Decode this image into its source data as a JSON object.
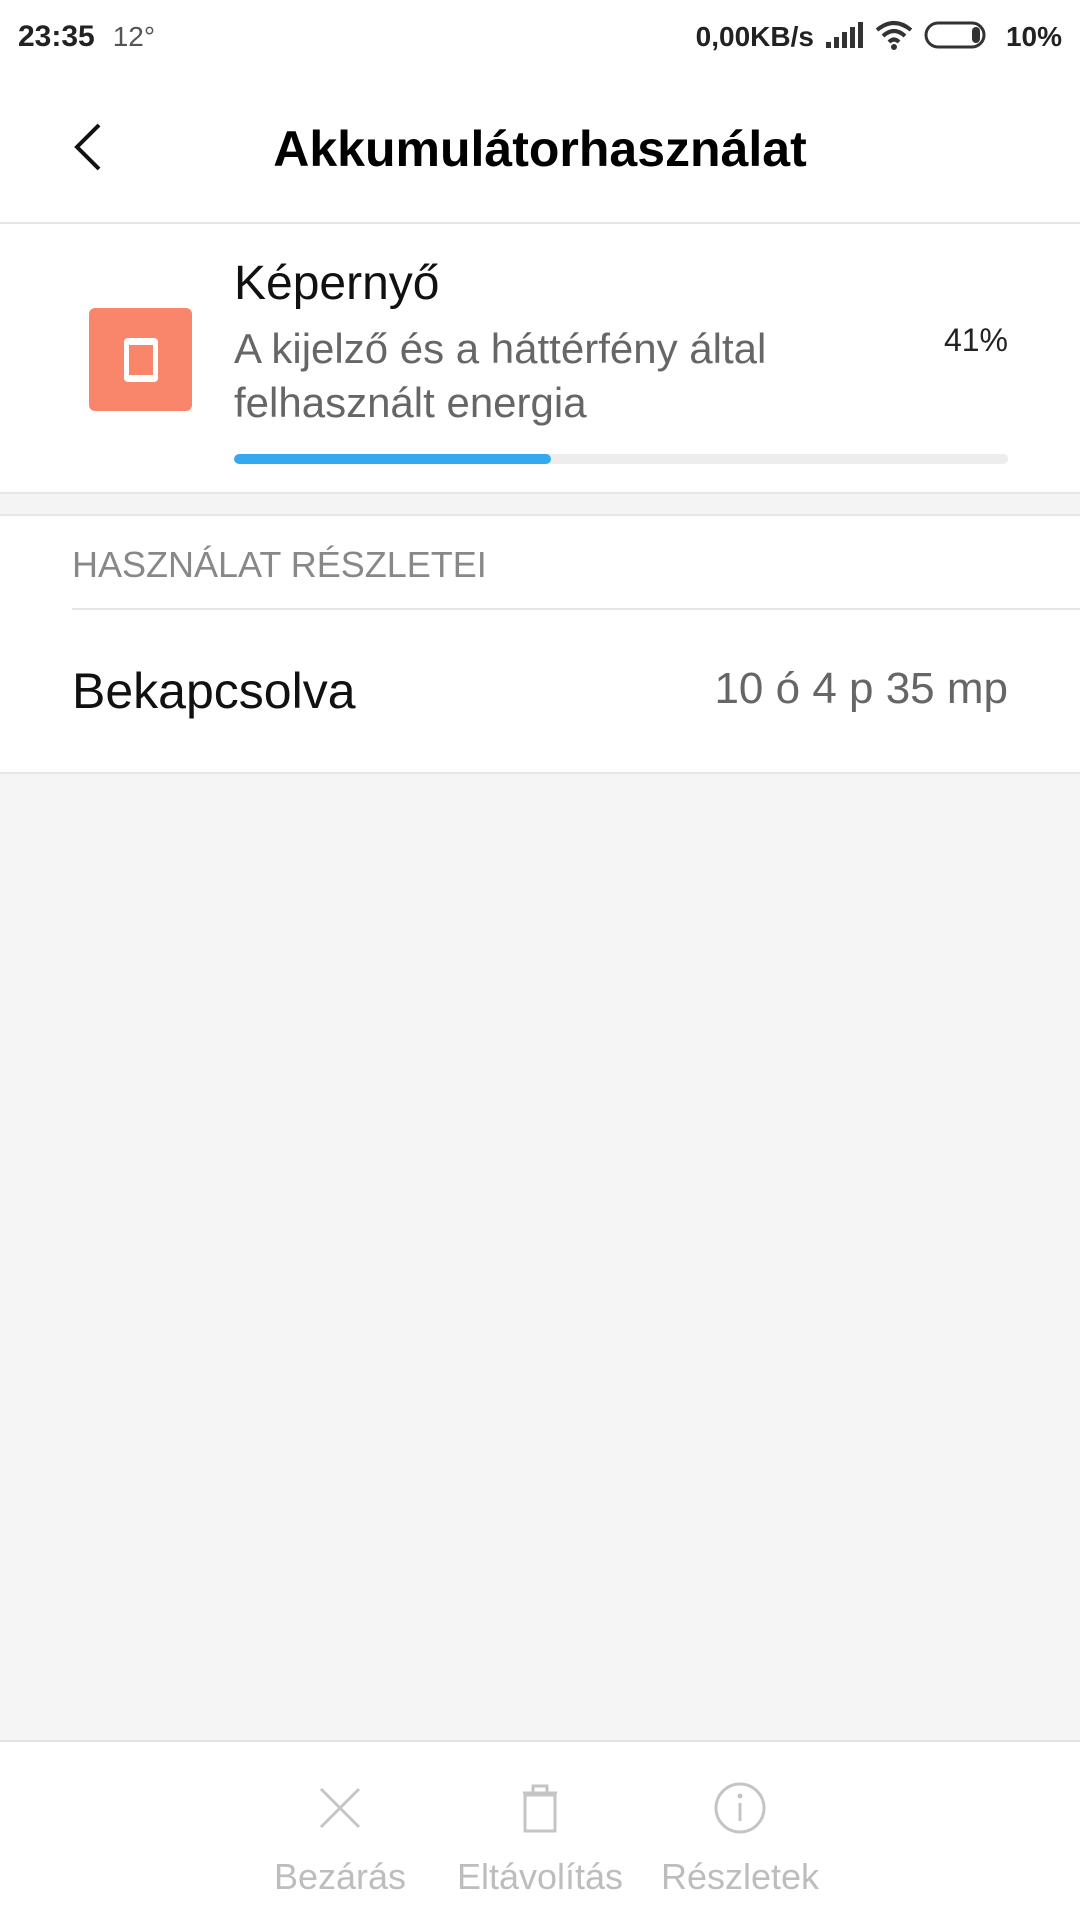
{
  "status_bar": {
    "time": "23:35",
    "temperature": "12°",
    "net_speed": "0,00KB/s",
    "battery_percent": "10%",
    "icons": [
      "signal-icon",
      "wifi-icon",
      "battery-icon"
    ]
  },
  "header": {
    "title": "Akkumulátorhasználat",
    "back_icon": "back-chevron-icon"
  },
  "app": {
    "name": "Képernyő",
    "description": "A kijelző és a háttérfény által felhasznált energia",
    "percent_label": "41%",
    "usage_fraction": 0.41,
    "icon": "screen-icon",
    "icon_color": "#f9866b",
    "progress_color": "#35a9f0"
  },
  "details": {
    "section_title": "HASZNÁLAT RÉSZLETEI",
    "rows": [
      {
        "label": "Bekapcsolva",
        "value": "10 ó 4 p 35 mp"
      }
    ]
  },
  "actions": [
    {
      "label": "Bezárás",
      "icon": "close-icon"
    },
    {
      "label": "Eltávolítás",
      "icon": "trash-icon"
    },
    {
      "label": "Részletek",
      "icon": "info-icon"
    }
  ]
}
